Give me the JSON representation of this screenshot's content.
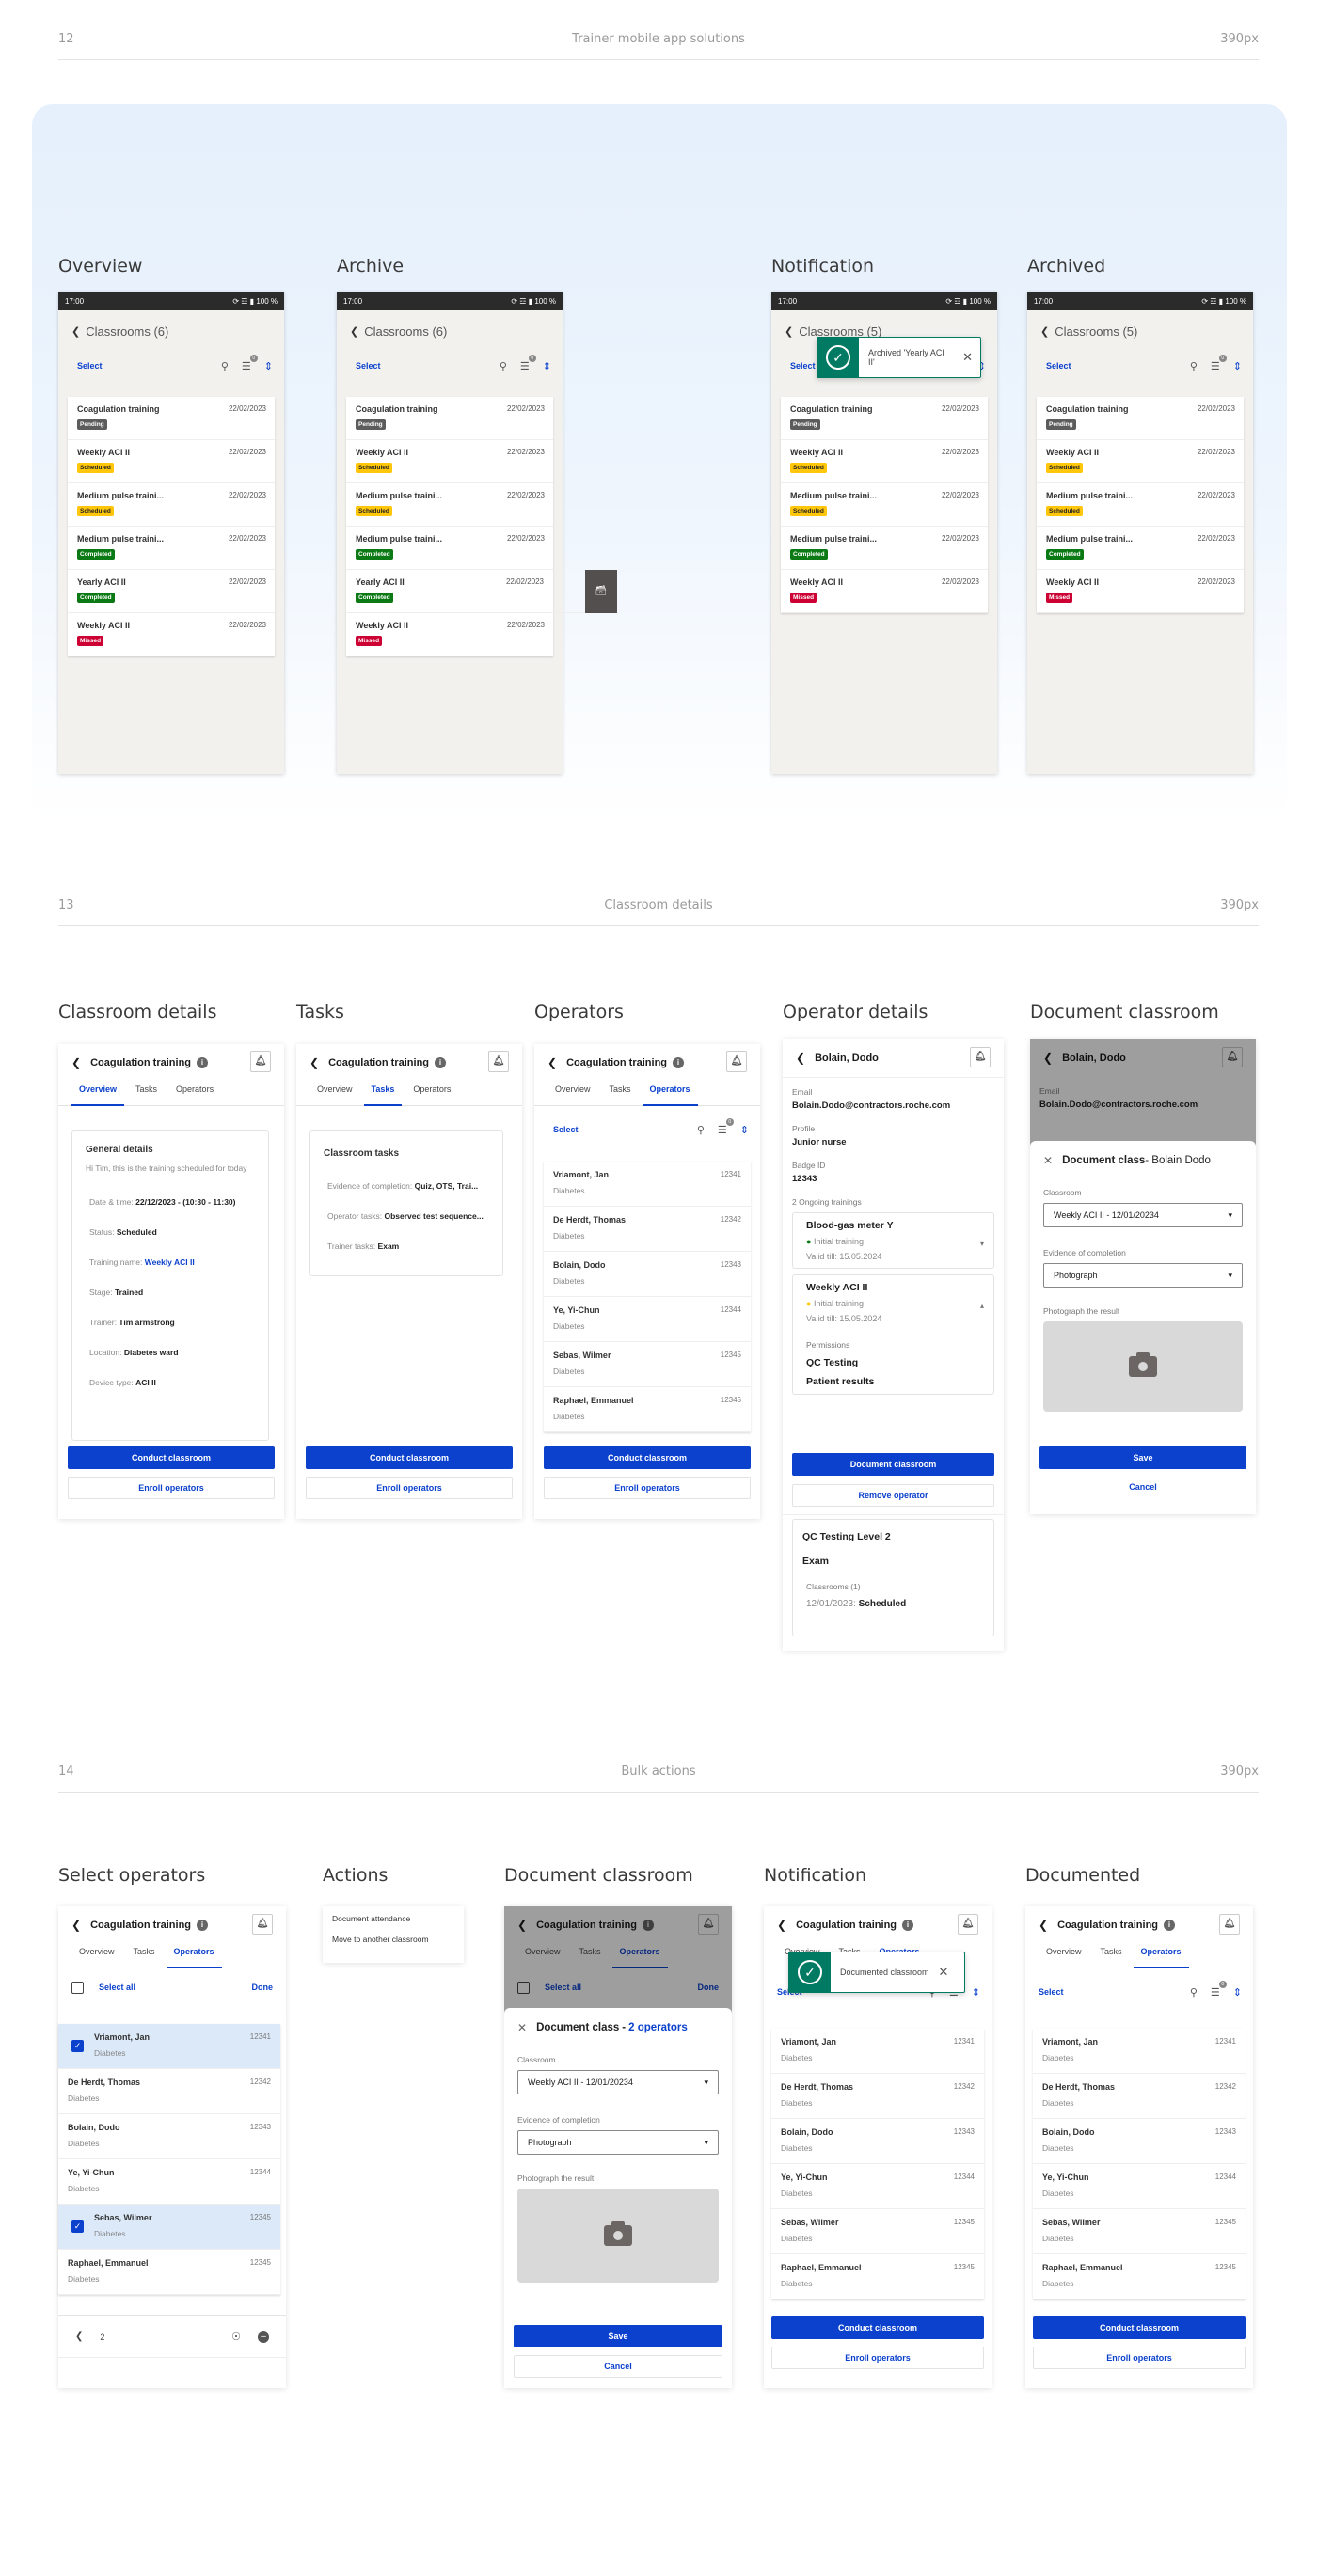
{
  "sections": [
    {
      "number": "12",
      "title": "Trainer mobile app solutions",
      "width_label": "390px"
    },
    {
      "number": "13",
      "title": "Classroom details",
      "width_label": "390px"
    },
    {
      "number": "14",
      "title": "Bulk actions",
      "width_label": "390px"
    }
  ],
  "status_bar": {
    "time": "17:00",
    "battery": "100 %"
  },
  "colors": {
    "primary": "#0b41cd",
    "success": "#017a63",
    "pending": "#5c5c5c",
    "scheduled": "#ffc60a",
    "completed": "#0b7a14",
    "missed": "#cc0033"
  },
  "section12": {
    "frames": [
      {
        "title": "Overview",
        "header": "Classrooms (6)"
      },
      {
        "title": "Archive",
        "header": "Classrooms (6)"
      },
      {
        "title": "Notification",
        "header": "Classrooms (5)",
        "toast": "Archived 'Yearly ACI II'"
      },
      {
        "title": "Archived",
        "header": "Classrooms (5)"
      }
    ],
    "select_label": "Select",
    "filter_count": "0",
    "classrooms": [
      {
        "name": "Coagulation training",
        "date": "22/02/2023",
        "status": "Pending"
      },
      {
        "name": "Weekly ACI II",
        "date": "22/02/2023",
        "status": "Scheduled"
      },
      {
        "name": "Medium pulse traini...",
        "date": "22/02/2023",
        "status": "Scheduled"
      },
      {
        "name": "Medium pulse traini...",
        "date": "22/02/2023",
        "status": "Completed"
      },
      {
        "name": "Yearly ACI II",
        "date": "22/02/2023",
        "status": "Completed"
      },
      {
        "name": "Weekly ACI II",
        "date": "22/02/2023",
        "status": "Missed"
      }
    ],
    "classrooms_after": [
      {
        "name": "Coagulation training",
        "date": "22/02/2023",
        "status": "Pending"
      },
      {
        "name": "Weekly ACI II",
        "date": "22/02/2023",
        "status": "Scheduled"
      },
      {
        "name": "Medium pulse traini...",
        "date": "22/02/2023",
        "status": "Scheduled"
      },
      {
        "name": "Medium pulse traini...",
        "date": "22/02/2023",
        "status": "Completed"
      },
      {
        "name": "Weekly ACI II",
        "date": "22/02/2023",
        "status": "Missed"
      }
    ]
  },
  "classroom": {
    "title": "Coagulation training",
    "tabs": [
      "Overview",
      "Tasks",
      "Operators"
    ],
    "general_title": "General details",
    "greeting": "Hi Tim, this is the training scheduled for today",
    "details": [
      {
        "label": "Date & time:",
        "value": "22/12/2023 - (10:30 - 11:30)"
      },
      {
        "label": "Status:",
        "value": "Scheduled"
      },
      {
        "label": "Training name:",
        "value": "Weekly ACI II",
        "link": true
      },
      {
        "label": "Stage:",
        "value": "Trained"
      },
      {
        "label": "Trainer:",
        "value": "Tim armstrong"
      },
      {
        "label": "Location:",
        "value": "Diabetes ward"
      },
      {
        "label": "Device type:",
        "value": "ACI II"
      }
    ],
    "tasks_title": "Classroom tasks",
    "tasks": [
      {
        "label": "Evidence of completion:",
        "value": "Quiz, OTS, Trai..."
      },
      {
        "label": "Operator tasks:",
        "value": "Observed test sequence..."
      },
      {
        "label": "Trainer tasks:",
        "value": "Exam"
      }
    ],
    "conduct_label": "Conduct classroom",
    "enroll_label": "Enroll operators",
    "select_label": "Select",
    "select_all_label": "Select all",
    "done_label": "Done"
  },
  "section13_titles": [
    "Classroom details",
    "Tasks",
    "Operators",
    "Operator details",
    "Document classroom"
  ],
  "operators": [
    {
      "name": "Vriamont, Jan",
      "dept": "Diabetes",
      "id": "12341"
    },
    {
      "name": "De Herdt, Thomas",
      "dept": "Diabetes",
      "id": "12342"
    },
    {
      "name": "Bolain, Dodo",
      "dept": "Diabetes",
      "id": "12343"
    },
    {
      "name": "Ye, Yi-Chun",
      "dept": "Diabetes",
      "id": "12344"
    },
    {
      "name": "Sebas, Wilmer",
      "dept": "Diabetes",
      "id": "12345"
    },
    {
      "name": "Raphael, Emmanuel",
      "dept": "Diabetes",
      "id": "12345"
    }
  ],
  "operator_detail": {
    "name": "Bolain, Dodo",
    "email_label": "Email",
    "email": "Bolain.Dodo@contractors.roche.com",
    "profile_label": "Profile",
    "profile": "Junior nurse",
    "badge_label": "Badge ID",
    "badge": "12343",
    "ongoing_label": "2 Ongoing trainings",
    "trainings": [
      {
        "name": "Blood-gas meter Y",
        "type": "Initial training",
        "valid": "Valid till: 15.05.2024"
      },
      {
        "name": "Weekly ACI II",
        "type": "Initial training",
        "valid": "Valid till: 15.05.2024"
      }
    ],
    "permissions_label": "Permissions",
    "permissions": [
      "QC Testing",
      "Patient results"
    ],
    "document_label": "Document classroom",
    "remove_label": "Remove operator",
    "extra": {
      "title": "QC Testing Level 2",
      "sub": "Exam",
      "classrooms_label": "Classrooms (1)",
      "date": "12/01/2023:",
      "status": "Scheduled"
    }
  },
  "document_form": {
    "title": "Document class",
    "single_target": " - Bolain Dodo",
    "bulk_target": "2 operators",
    "classroom_label": "Classroom",
    "classroom_value": "Weekly ACI II - 12/01/20234",
    "evidence_label": "Evidence of completion",
    "evidence_value": "Photograph",
    "photo_label": "Photograph the result",
    "save_label": "Save",
    "cancel_label": "Cancel"
  },
  "section14": {
    "titles": [
      "Select operators",
      "Actions",
      "Document classroom",
      "Notification",
      "Documented"
    ],
    "actions": [
      "Document attendance",
      "Move to another classroom"
    ],
    "selected_count": "2",
    "toast": "Documented classroom"
  }
}
